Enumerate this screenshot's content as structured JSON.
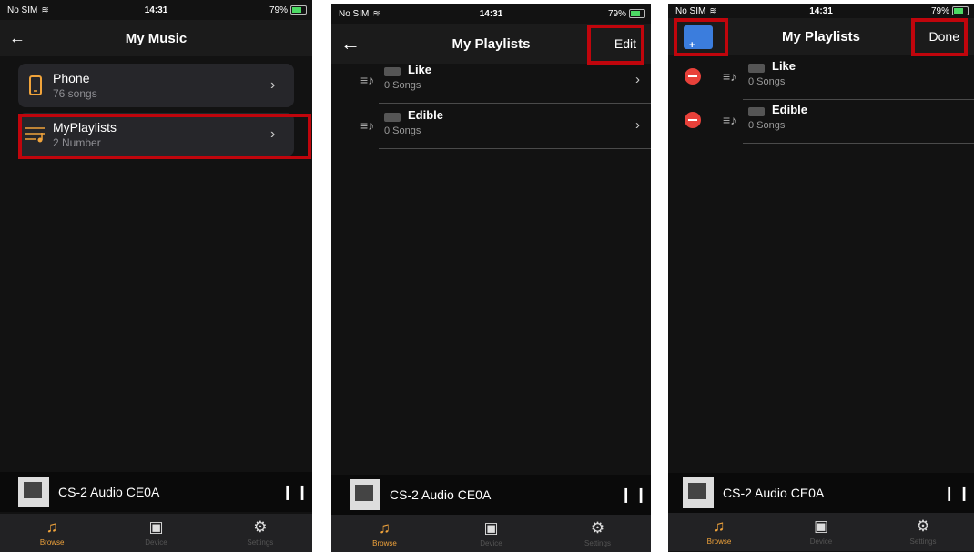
{
  "status": {
    "carrier": "No SIM",
    "time": "14:31",
    "battery": "79%"
  },
  "screen1": {
    "title": "My Music",
    "items": [
      {
        "title": "Phone",
        "subtitle": "76 songs",
        "icon": "phone-icon"
      },
      {
        "title": "MyPlaylists",
        "subtitle": "2 Number",
        "icon": "playlist-icon"
      }
    ]
  },
  "screen2": {
    "title": "My Playlists",
    "action": "Edit",
    "items": [
      {
        "name": "Like",
        "count": "0 Songs"
      },
      {
        "name": "Edible",
        "count": "0 Songs"
      }
    ]
  },
  "screen3": {
    "title": "My Playlists",
    "action": "Done",
    "items": [
      {
        "name": "Like",
        "count": "0 Songs"
      },
      {
        "name": "Edible",
        "count": "0 Songs"
      }
    ]
  },
  "player": {
    "title": "CS-2 Audio CE0A"
  },
  "tabs": [
    {
      "label": "Browse",
      "icon": "music-note-icon",
      "glyph": "♫"
    },
    {
      "label": "Device",
      "icon": "speaker-icon",
      "glyph": "▣"
    },
    {
      "label": "Settings",
      "icon": "sliders-icon",
      "glyph": "⚙"
    }
  ],
  "colors": {
    "highlight": "#c0050c",
    "accent": "#f0a33b",
    "delete": "#e8413a",
    "folder": "#3b7ddd"
  }
}
